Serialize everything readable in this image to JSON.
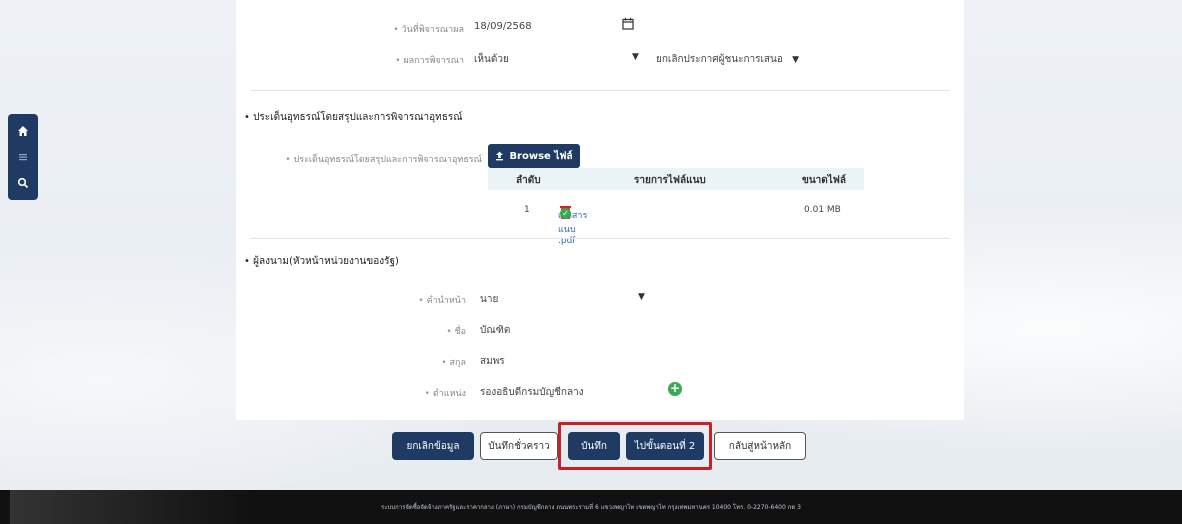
{
  "form": {
    "date_label": "วันที่พิจารณาผล",
    "date_value": "18/09/2568",
    "result_label": "ผลการพิจารณา",
    "result_value": "เห็นด้วย",
    "result_reason_value": "ยกเลิกประกาศผู้ชนะการเสนอ"
  },
  "attachment_section": {
    "title": "ประเด็นอุทธรณ์โดยสรุปและการพิจารณาอุทธรณ์",
    "upload_label": "ประเด็นอุทธรณ์โดยสรุปและการพิจารณาอุทธรณ์",
    "browse_button": "Browse ไฟล์",
    "columns": [
      "ลำดับ",
      "รายการไฟล์แนบ",
      "ขนาดไฟล์"
    ],
    "rows": [
      {
        "no": "1",
        "file_name": "เอกสารแนบ .pdf",
        "size": "0.01 MB"
      }
    ]
  },
  "signer_section": {
    "title": "ผู้ลงนาม(หัวหน้าหน่วยงานของรัฐ)",
    "prefix_label": "คำนำหน้า",
    "prefix_value": "นาย",
    "first_name_label": "ชื่อ",
    "first_name_value": "บัณฑิต",
    "last_name_label": "สกุล",
    "last_name_value": "สมพร",
    "position_label": "ตำแหน่ง",
    "position_value": "รองอธิบดีกรมบัญชีกลาง"
  },
  "actions": {
    "cancel": "ยกเลิกข้อมูล",
    "save_draft": "บันทึกชั่วคราว",
    "save": "บันทึก",
    "next_step": "ไปขั้นตอนที่ 2",
    "back_home": "กลับสู่หน้าหลัก"
  },
  "footer": {
    "text": "ระบบการจัดซื้อจัดจ้างภาครัฐและราคากลาง (ภาษา) กรมบัญชีกลาง ถนนพระรามที่ 6 แขวงพญาไท เขตพญาไท กรุงเทพมหานคร 10400 โทร. 0-2270-6400 กด 3"
  },
  "colors": {
    "primary": "#1f3b63",
    "highlight": "#c8202b",
    "success": "#3aaa55",
    "danger": "#dd2222"
  }
}
